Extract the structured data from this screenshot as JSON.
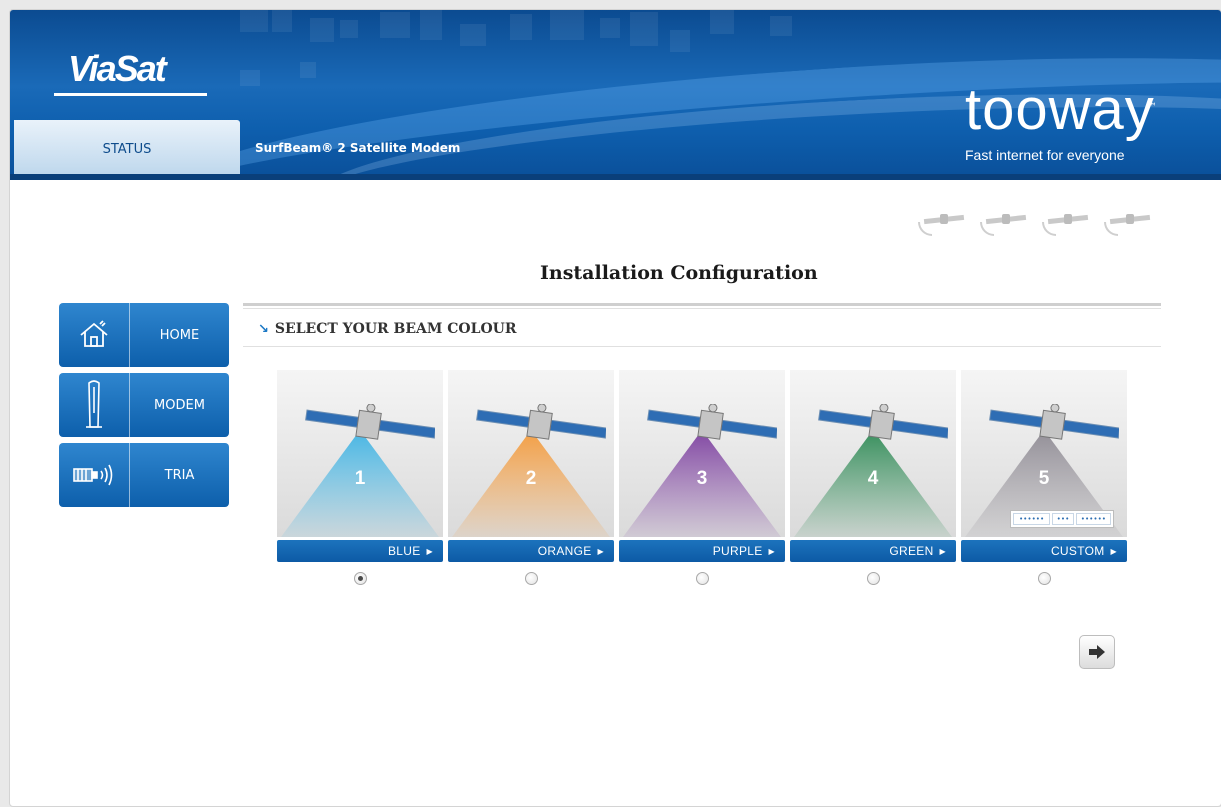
{
  "header": {
    "brand_logo": "ViaSat",
    "product_logo": "tooway",
    "product_tm": "™",
    "tagline": "Fast internet for everyone",
    "status_tab": "STATUS",
    "product_name": "SurfBeam® 2 Satellite Modem"
  },
  "progress": {
    "steps": 4,
    "icon": "satellite-icon"
  },
  "page": {
    "title": "Installation Configuration",
    "section_heading": "SELECT YOUR BEAM COLOUR"
  },
  "nav": {
    "items": [
      {
        "label": "HOME",
        "icon": "home-icon"
      },
      {
        "label": "MODEM",
        "icon": "modem-icon"
      },
      {
        "label": "TRIA",
        "icon": "tria-icon"
      }
    ]
  },
  "beams": [
    {
      "number": "1",
      "label": "BLUE",
      "color": "#3fb3e3",
      "selected": true
    },
    {
      "number": "2",
      "label": "ORANGE",
      "color": "#f39a3b",
      "selected": false
    },
    {
      "number": "3",
      "label": "PURPLE",
      "color": "#7c3f9f",
      "selected": false
    },
    {
      "number": "4",
      "label": "GREEN",
      "color": "#2e8a55",
      "selected": false
    },
    {
      "number": "5",
      "label": "CUSTOM",
      "color": "#8e8a93",
      "selected": false
    }
  ],
  "custom_fields": [
    "••••••",
    "•••",
    "••••••"
  ],
  "colors": {
    "accent": "#0d5fab",
    "header": "#1a6ab8"
  }
}
